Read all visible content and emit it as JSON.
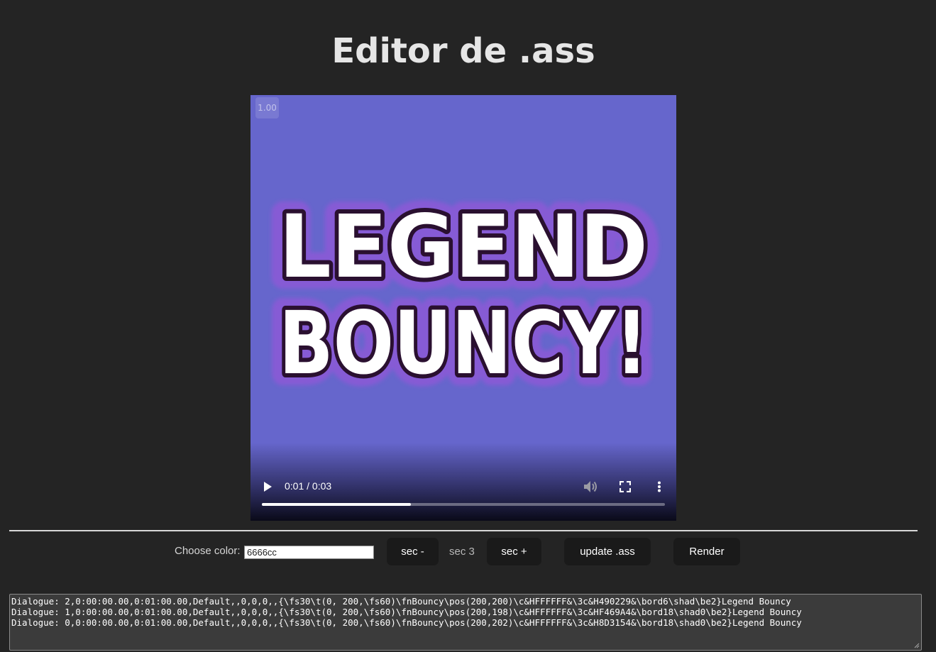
{
  "page": {
    "title": "Editor de .ass"
  },
  "player": {
    "speed_badge": "1.00",
    "time_display": "0:01 / 0:03",
    "progress_fraction": 0.37,
    "background_color": "#6666cc",
    "artwork_text": [
      "LEGEND",
      "BOUNCY!"
    ],
    "icons": {
      "play": "play-icon",
      "volume": "volume-icon",
      "fullscreen": "fullscreen-icon",
      "more": "more-vertical-icon"
    }
  },
  "toolbar": {
    "color_label": "Choose color:",
    "color_value": "6666cc",
    "sec_minus_label": "sec -",
    "sec_value_label": "sec 3",
    "sec_plus_label": "sec +",
    "update_label": "update .ass",
    "render_label": "Render"
  },
  "editor": {
    "lines": [
      "Dialogue: 2,0:00:00.00,0:01:00.00,Default,,0,0,0,,{\\fs30\\t(0, 200,\\fs60)\\fnBouncy\\pos(200,200)\\c&HFFFFFF&\\3c&H490229&\\bord6\\shad\\be2}Legend Bouncy",
      "Dialogue: 1,0:00:00.00,0:01:00.00,Default,,0,0,0,,{\\fs30\\t(0, 200,\\fs60)\\fnBouncy\\pos(200,198)\\c&HFFFFFF&\\3c&HF469A4&\\bord18\\shad0\\be2}Legend Bouncy",
      "Dialogue: 0,0:00:00.00,0:01:00.00,Default,,0,0,0,,{\\fs30\\t(0, 200,\\fs60)\\fnBouncy\\pos(200,202)\\c&HFFFFFF&\\3c&H8D3154&\\bord18\\shad0\\be2}Legend Bouncy"
    ]
  },
  "colors": {
    "background": "#242424",
    "button_bg": "#1a1a1a",
    "video_bg": "#6666cc",
    "text_outline_dark": "#2a1030",
    "text_glow": "#8a5ad6"
  }
}
